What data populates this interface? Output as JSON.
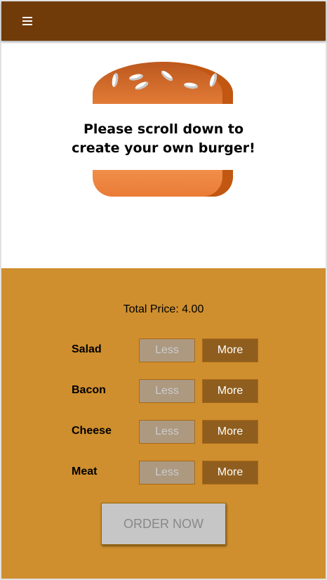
{
  "toolbar": {
    "menu_icon": "hamburger-menu-icon"
  },
  "burger": {
    "message_line1": "Please scroll down to",
    "message_line2": "create your own burger!"
  },
  "controls": {
    "total_price_label": "Total Price: 4.00",
    "ingredients": [
      {
        "label": "Salad",
        "less": "Less",
        "more": "More"
      },
      {
        "label": "Bacon",
        "less": "Less",
        "more": "More"
      },
      {
        "label": "Cheese",
        "less": "Less",
        "more": "More"
      },
      {
        "label": "Meat",
        "less": "Less",
        "more": "More"
      }
    ],
    "order_label": "ORDER NOW"
  },
  "colors": {
    "toolbar": "#703b09",
    "controls_background": "#cf8f2e",
    "more_button": "#8f5e1e",
    "less_button_disabled": "#ac9980",
    "order_button_disabled": "#c7c6c6",
    "bun": "#e27b36"
  }
}
